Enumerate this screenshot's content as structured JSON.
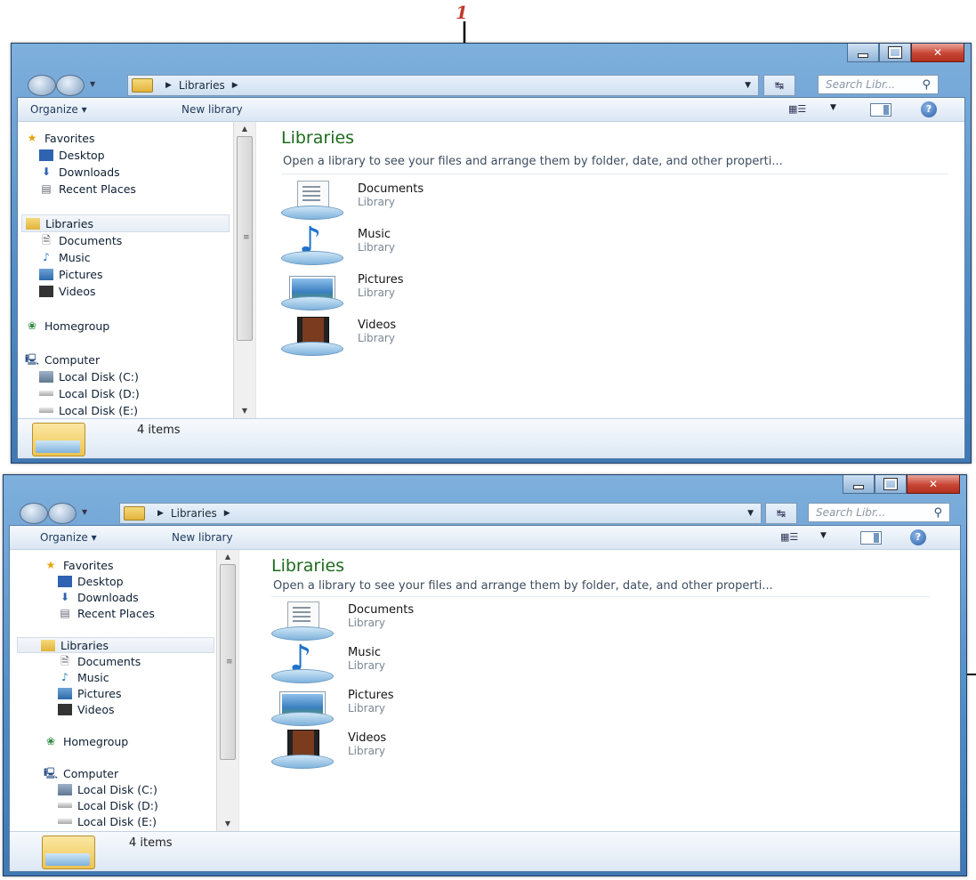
{
  "annotation": {
    "step_number": "1"
  },
  "window": {
    "address": {
      "location": "Libraries"
    },
    "search": {
      "placeholder": "Search Libr..."
    },
    "toolbar": {
      "organize": "Organize ▾",
      "new_library": "New library"
    },
    "nav": {
      "favorites": "Favorites",
      "favorites_items": [
        "Desktop",
        "Downloads",
        "Recent Places"
      ],
      "libraries": "Libraries",
      "libraries_items": [
        "Documents",
        "Music",
        "Pictures",
        "Videos"
      ],
      "homegroup": "Homegroup",
      "computer": "Computer",
      "computer_items": [
        "Local Disk (C:)",
        "Local Disk (D:)",
        "Local Disk (E:)"
      ]
    },
    "content": {
      "title": "Libraries",
      "subtitle": "Open a library to see your files and arrange them by folder, date, and other properti...",
      "libraries": [
        {
          "name": "Documents",
          "type": "Library",
          "icon": "documents-library-icon"
        },
        {
          "name": "Music",
          "type": "Library",
          "icon": "music-library-icon"
        },
        {
          "name": "Pictures",
          "type": "Library",
          "icon": "pictures-library-icon"
        },
        {
          "name": "Videos",
          "type": "Library",
          "icon": "videos-library-icon"
        }
      ]
    },
    "status": {
      "item_count": "4 items"
    }
  },
  "colors": {
    "title_green": "#1e6b1e",
    "close_red": "#c74534",
    "frame_blue": "#4f8bc4"
  }
}
